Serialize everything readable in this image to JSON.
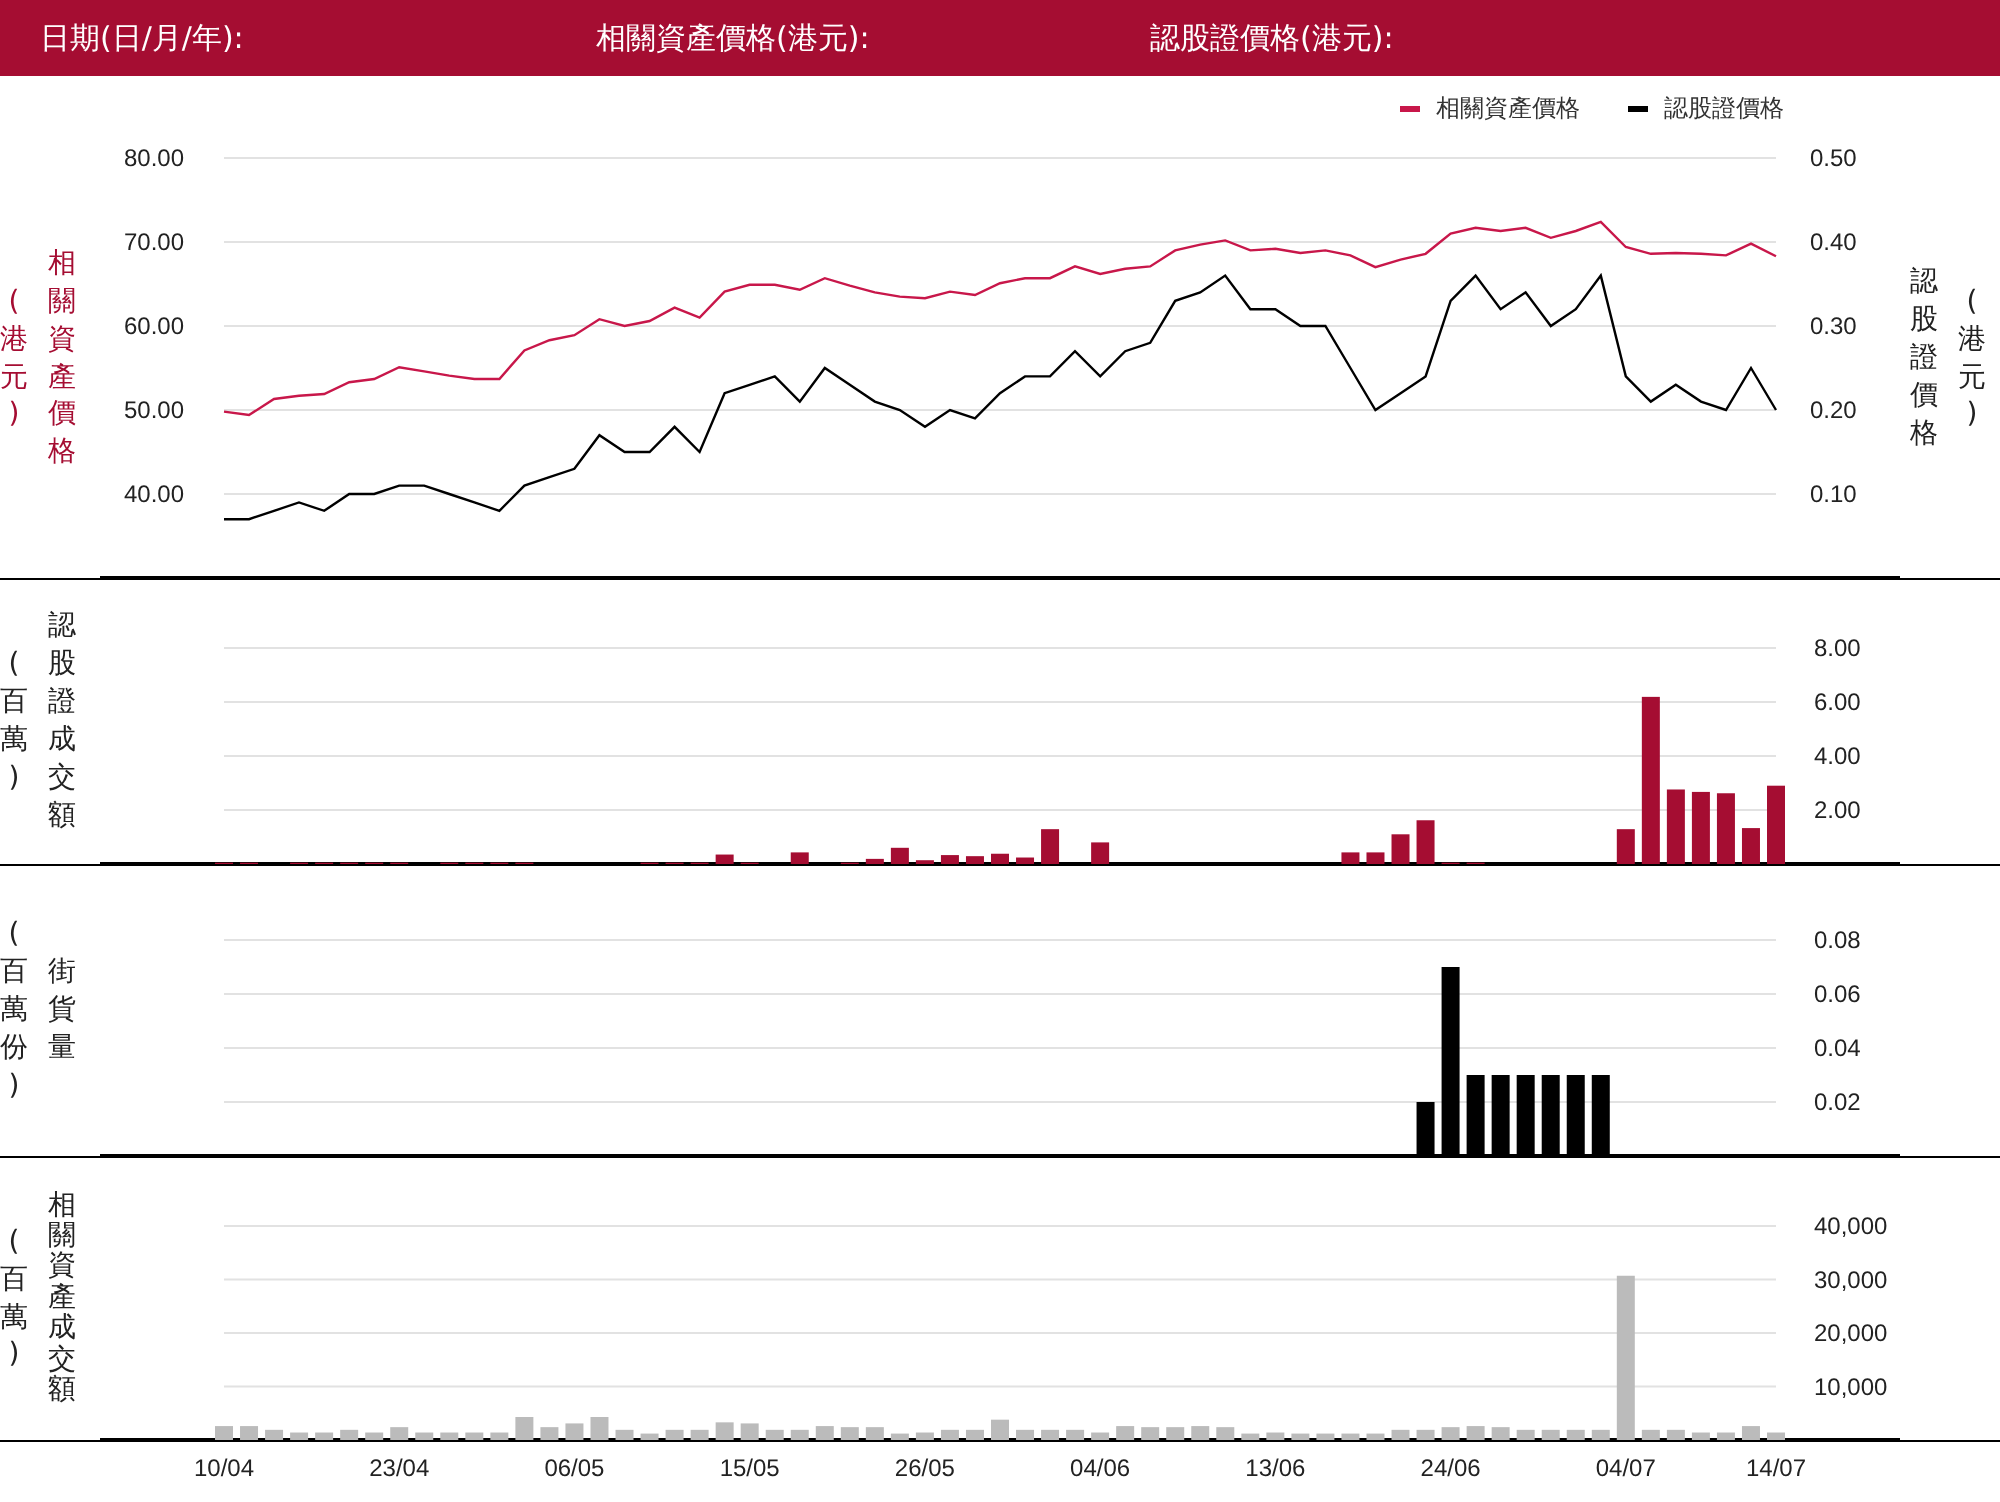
{
  "header": {
    "fields": [
      {
        "label": "日期(日/月/年):"
      },
      {
        "label": "相關資產價格(港元):"
      },
      {
        "label": "認股證價格(港元):"
      }
    ]
  },
  "legend": [
    {
      "label": "相關資產價格",
      "color": "#c8174a"
    },
    {
      "label": "認股證價格",
      "color": "#000000"
    }
  ],
  "price_chart": {
    "left_axis_unit": "(港元)",
    "right_axis_unit": "(港元)",
    "chart_data": {
      "type": "line",
      "grid": true,
      "ylim": [
        30,
        80
      ],
      "yticks": [
        {
          "value": 40,
          "label": "40.00"
        },
        {
          "value": 50,
          "label": "50.00"
        },
        {
          "value": 60,
          "label": "60.00"
        },
        {
          "value": 70,
          "label": "70.00"
        },
        {
          "value": 80,
          "label": "80.00"
        }
      ],
      "y2lim": [
        0,
        0.5
      ],
      "y2ticks": [
        {
          "value": 0.1,
          "label": "0.10"
        },
        {
          "value": 0.2,
          "label": "0.20"
        },
        {
          "value": 0.3,
          "label": "0.30"
        },
        {
          "value": 0.4,
          "label": "0.40"
        },
        {
          "value": 0.5,
          "label": "0.50"
        }
      ],
      "series": [
        {
          "name": "相關資產價格",
          "color": "#c8174a",
          "values": [
            49.8,
            49.4,
            51.3,
            51.7,
            51.9,
            53.3,
            53.7,
            55.1,
            54.6,
            54.1,
            53.7,
            53.7,
            57.1,
            58.3,
            58.9,
            60.8,
            60.0,
            60.6,
            62.2,
            61.0,
            64.1,
            64.9,
            64.9,
            64.3,
            65.7,
            64.8,
            64.0,
            63.5,
            63.3,
            64.1,
            63.7,
            65.1,
            65.7,
            65.7,
            67.1,
            66.2,
            66.8,
            67.1,
            69.0,
            69.7,
            70.2,
            69.0,
            69.2,
            68.7,
            69.0,
            68.4,
            67.0,
            67.9,
            68.6,
            71.0,
            71.7,
            71.3,
            71.7,
            70.5,
            71.3,
            72.4,
            69.4,
            68.6,
            68.7,
            68.6,
            68.4,
            69.8,
            68.3
          ]
        },
        {
          "name": "認股證價格",
          "color": "#000000",
          "axis": "y2",
          "values": [
            0.07,
            0.07,
            0.08,
            0.09,
            0.08,
            0.1,
            0.1,
            0.11,
            0.11,
            0.1,
            0.09,
            0.08,
            0.11,
            0.12,
            0.13,
            0.17,
            0.15,
            0.15,
            0.18,
            0.15,
            0.22,
            0.23,
            0.24,
            0.21,
            0.25,
            0.23,
            0.21,
            0.2,
            0.18,
            0.2,
            0.19,
            0.22,
            0.24,
            0.24,
            0.27,
            0.24,
            0.27,
            0.28,
            0.33,
            0.34,
            0.36,
            0.32,
            0.32,
            0.3,
            0.3,
            0.25,
            0.2,
            0.22,
            0.24,
            0.33,
            0.36,
            0.32,
            0.34,
            0.3,
            0.32,
            0.36,
            0.24,
            0.21,
            0.23,
            0.21,
            0.2,
            0.25,
            0.2
          ]
        }
      ]
    }
  },
  "warrant_turnover_chart": {
    "left_axis_unit": "(百萬)",
    "chart_data": {
      "type": "bar",
      "grid": true,
      "ylim": [
        0,
        8
      ],
      "yticks": [
        {
          "value": 2,
          "label": "2.00"
        },
        {
          "value": 4,
          "label": "4.00"
        },
        {
          "value": 6,
          "label": "6.00"
        },
        {
          "value": 8,
          "label": "8.00"
        }
      ],
      "series": [
        {
          "name": "認股證成交額",
          "color": "#a50d32",
          "values": [
            0.05,
            0.05,
            null,
            0.05,
            0.05,
            0.05,
            0.05,
            0.05,
            null,
            0.05,
            0.05,
            0.05,
            0.05,
            null,
            null,
            null,
            null,
            0.05,
            0.05,
            0.05,
            0.35,
            0.05,
            null,
            0.43,
            null,
            0.05,
            0.19,
            0.6,
            0.14,
            0.33,
            0.29,
            0.38,
            0.24,
            1.29,
            null,
            0.8,
            null,
            null,
            null,
            null,
            null,
            null,
            null,
            null,
            null,
            0.43,
            0.43,
            1.1,
            1.62,
            0.05,
            0.05,
            null,
            null,
            null,
            null,
            null,
            1.29,
            6.19,
            2.76,
            2.67,
            2.62,
            1.33,
            2.9
          ]
        }
      ]
    }
  },
  "outstanding_chart": {
    "left_axis_unit": "(百萬份)",
    "chart_data": {
      "type": "bar",
      "grid": true,
      "ylim": [
        0,
        0.08
      ],
      "yticks": [
        {
          "value": 0.02,
          "label": "0.02"
        },
        {
          "value": 0.04,
          "label": "0.04"
        },
        {
          "value": 0.06,
          "label": "0.06"
        },
        {
          "value": 0.08,
          "label": "0.08"
        }
      ],
      "series": [
        {
          "name": "街貨量",
          "color": "#000000",
          "values": [
            null,
            null,
            null,
            null,
            null,
            null,
            null,
            null,
            null,
            null,
            null,
            null,
            null,
            null,
            null,
            null,
            null,
            null,
            null,
            null,
            null,
            null,
            null,
            null,
            null,
            null,
            null,
            null,
            null,
            null,
            null,
            null,
            null,
            null,
            null,
            null,
            null,
            null,
            null,
            null,
            null,
            null,
            null,
            null,
            null,
            null,
            null,
            null,
            0.02,
            0.07,
            0.03,
            0.03,
            0.03,
            0.03,
            0.03,
            0.03,
            null,
            null,
            null,
            null,
            null,
            null,
            null
          ]
        }
      ]
    }
  },
  "asset_turnover_chart": {
    "left_axis_unit": "(百萬)",
    "chart_data": {
      "type": "bar",
      "grid": true,
      "ylim": [
        0,
        40000
      ],
      "yticks": [
        {
          "value": 10000,
          "label": "10,000"
        },
        {
          "value": 20000,
          "label": "20,000"
        },
        {
          "value": 30000,
          "label": "30,000"
        },
        {
          "value": 40000,
          "label": "40,000"
        }
      ],
      "series": [
        {
          "name": "相關資產成交額",
          "color": "#bbbbbb",
          "values": [
            2600,
            2600,
            1900,
            1400,
            1400,
            1900,
            1400,
            2400,
            1400,
            1400,
            1400,
            1400,
            4300,
            2400,
            3100,
            4300,
            1900,
            1200,
            1900,
            1900,
            3300,
            3100,
            1900,
            1900,
            2600,
            2400,
            2400,
            1200,
            1400,
            1900,
            1900,
            3800,
            1900,
            1900,
            1900,
            1400,
            2600,
            2400,
            2400,
            2600,
            2400,
            1200,
            1400,
            1200,
            1200,
            1200,
            1200,
            1900,
            1900,
            2400,
            2600,
            2400,
            1900,
            1900,
            1900,
            1900,
            30700,
            1900,
            1900,
            1400,
            1400,
            2600,
            1400
          ]
        }
      ]
    },
    "x_labels": [
      "10/04",
      "23/04",
      "06/05",
      "15/05",
      "26/05",
      "04/06",
      "13/06",
      "24/06",
      "04/07",
      "14/07"
    ]
  }
}
